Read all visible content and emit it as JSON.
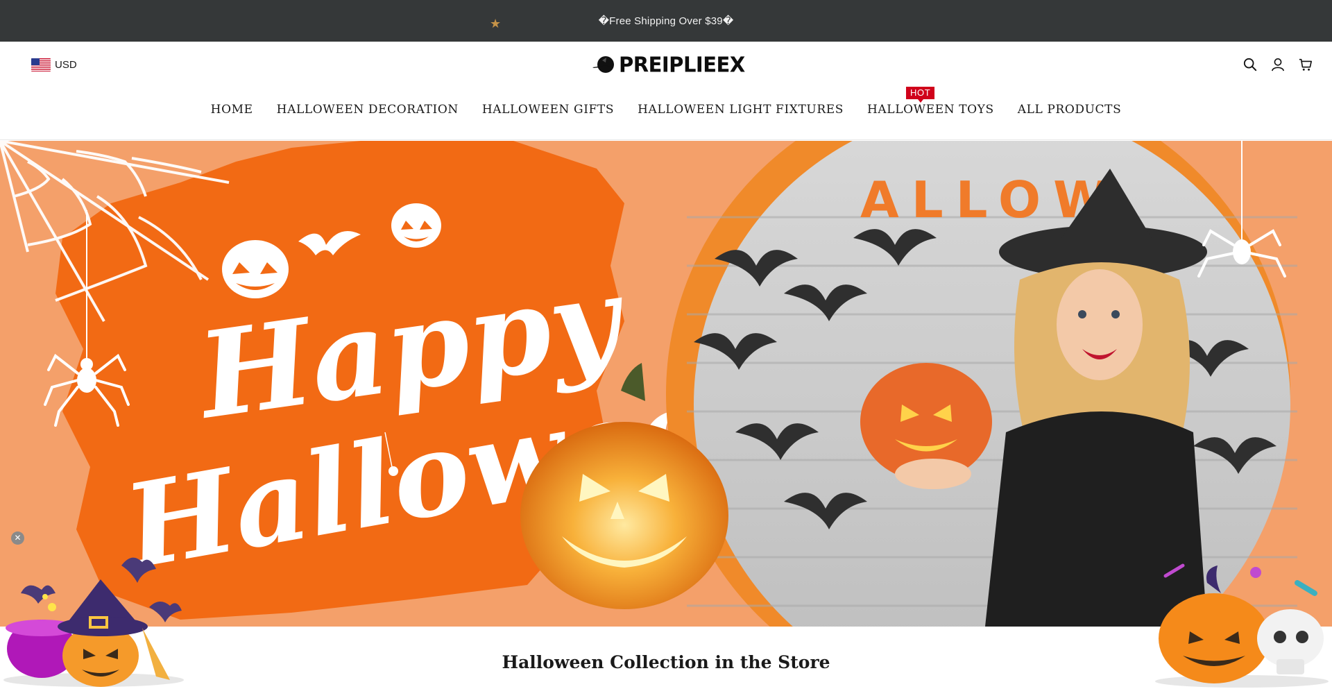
{
  "announcement": {
    "text": "�Free Shipping Over $39�"
  },
  "header": {
    "currency": "USD",
    "logo_text": "PREIPLIEEX",
    "icons": [
      "search-icon",
      "account-icon",
      "cart-icon"
    ]
  },
  "nav": {
    "items": [
      {
        "label": "HOME"
      },
      {
        "label": "HALLOWEEN DECORATION"
      },
      {
        "label": "HALLOWEEN GIFTS"
      },
      {
        "label": "HALLOWEEN LIGHT FIXTURES"
      },
      {
        "label": "HALLOWEEN TOYS",
        "badge": "HOT"
      },
      {
        "label": "ALL PRODUCTS"
      }
    ]
  },
  "hero": {
    "headline": "Happy Halloween",
    "sign_text": "ALLOW"
  },
  "section": {
    "title": "Halloween Collection in the Store"
  },
  "colors": {
    "announcement_bg": "#353839",
    "hero_bg": "#f4a06a",
    "brush_orange": "#f26a14",
    "badge_red": "#d0021b"
  }
}
